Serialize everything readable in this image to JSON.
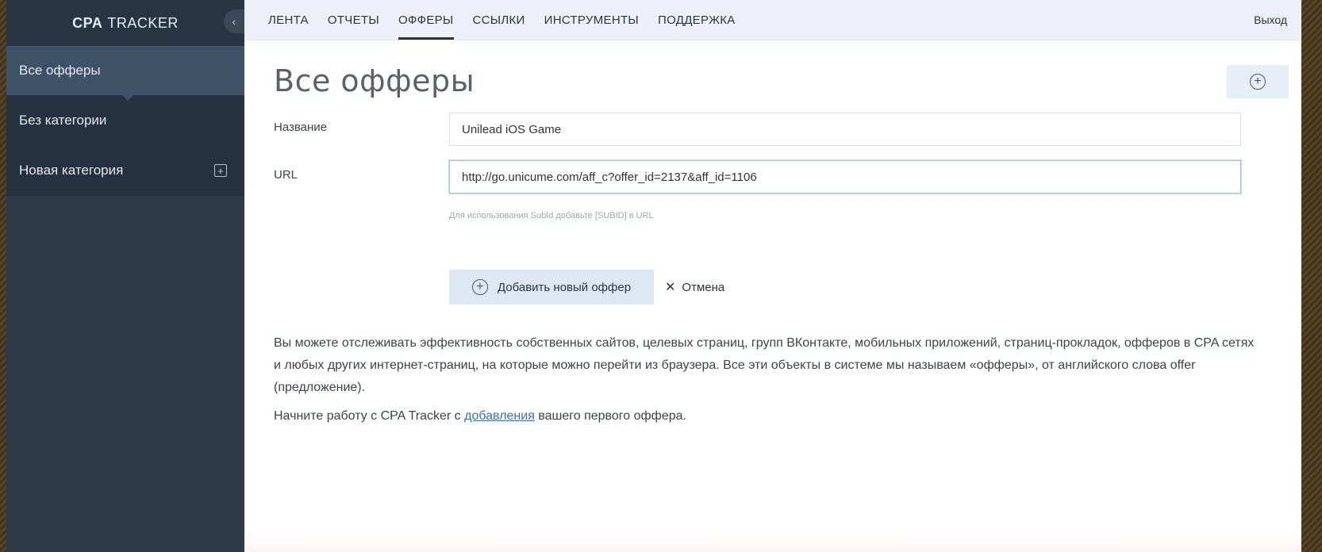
{
  "brand": {
    "strong": "CPA",
    "rest": "TRACKER"
  },
  "sidebar": {
    "collapse_icon": "chevron-left-icon",
    "items": [
      {
        "label": "Все офферы"
      },
      {
        "label": "Без категории"
      },
      {
        "label": "Новая категория",
        "icon": "plus-square-icon"
      }
    ]
  },
  "topnav": {
    "tabs": [
      {
        "label": "ЛЕНТА"
      },
      {
        "label": "ОТЧЕТЫ"
      },
      {
        "label": "ОФФЕРЫ",
        "active": true
      },
      {
        "label": "ССЫЛКИ"
      },
      {
        "label": "ИНСТРУМЕНТЫ"
      },
      {
        "label": "ПОДДЕРЖКА"
      }
    ],
    "logout": "Выход"
  },
  "page": {
    "title": "Все офферы",
    "add_icon": "circle-plus-icon"
  },
  "form": {
    "name_label": "Название",
    "name_value": "Unilead iOS Game",
    "url_label": "URL",
    "url_value": "http://go.unicume.com/aff_c?offer_id=2137&aff_id=1106",
    "url_hint": "Для использования SubId добавьте [SUBID] в URL",
    "submit_label": "Добавить новый оффер",
    "cancel_label": "Отмена"
  },
  "info": {
    "paragraph": "Вы можете отслеживать эффективность собственных сайтов, целевых страниц, групп ВКонтакте, мобильных приложений, страниц-прокладок, офферов в CPA сетях и любых других интернет-страниц, на которые можно перейти из браузера. Все эти объекты в системе мы называем «офферы», от английского слова offer (предложение).",
    "cta_before": "Начните работу с CPA Tracker с ",
    "cta_link": "добавления",
    "cta_after": " вашего первого оффера."
  },
  "colors": {
    "sidebar_bg": "#2f3b4b",
    "sidebar_active": "#3e5368",
    "topnav_bg": "#edf1f7",
    "button_bg": "#dde7f3",
    "link": "#3a6fb8"
  }
}
